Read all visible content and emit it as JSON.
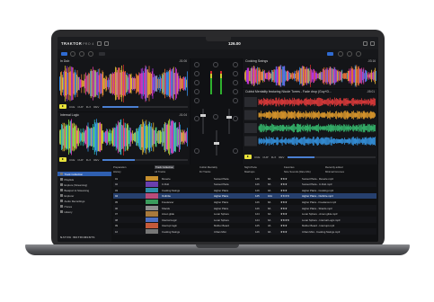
{
  "app": {
    "name": "TRAKTOR",
    "edition": "PRO 4",
    "brand": "NATIVE INSTRUMENTS"
  },
  "master": {
    "bpm": "126.00"
  },
  "colors": {
    "accent": "#2f6bd2",
    "play": "#e8e23a",
    "selection": "#26406e"
  },
  "decks": [
    {
      "id": "A",
      "title": "In Dub",
      "time": "-01:06",
      "position": 0.42
    },
    {
      "id": "B",
      "title": "Cooking Swings",
      "time": "-03:16",
      "position": 0.55
    },
    {
      "id": "C",
      "title": "Internal Logic",
      "time": "-01:04",
      "position": 0.38
    },
    {
      "id": "D",
      "title": "Cubist Mentality featuring Nicole Torres - Fade drop (Guy+D...",
      "time": "-05:01",
      "position": 0.3
    }
  ],
  "deck_buttons": [
    "CUE",
    "CUP",
    "FLX",
    "REV"
  ],
  "sidebar": {
    "items": [
      {
        "label": "Track Collection",
        "selected": true
      },
      {
        "label": "Playlists"
      },
      {
        "label": "Explore (Streaming)"
      },
      {
        "label": "Beatport & Streaming"
      },
      {
        "label": "Explorer"
      },
      {
        "label": "Audio Recordings"
      },
      {
        "label": "iTunes"
      },
      {
        "label": "History"
      }
    ]
  },
  "favorites": [
    "Preparation",
    "Track Collection",
    "Cubist Mentality",
    "Night Parte",
    "Favorites",
    "Recently added",
    "History",
    "All Tracks",
    "DJ Tracks",
    "Mashups",
    "Nice Sounds (Rare Mix)",
    "Minimal Grooves"
  ],
  "tracks": [
    {
      "n": "01",
      "title": "Reverie",
      "artist": "Sunset Plaza",
      "bpm": "126",
      "key": "8A",
      "rating": "★★★",
      "label": "Sunset Plaza - Reverie.mp3"
    },
    {
      "n": "02",
      "title": "In Dub",
      "artist": "Sunset Plaza",
      "bpm": "126",
      "key": "8A",
      "rating": "★★★",
      "label": "Sunset Plaza - In Dub.mp3"
    },
    {
      "n": "03",
      "title": "Cooking Swings",
      "artist": "Higher Plaza",
      "bpm": "126",
      "key": "9A",
      "rating": "★★★",
      "label": "Higher Plaza - Cooking.mp3"
    },
    {
      "n": "04",
      "title": "Outbrite",
      "artist": "Higher Plaza",
      "bpm": "125",
      "key": "10A",
      "rating": "★★★★",
      "label": "Higher Plaza - Outbrite.mp3",
      "selected": true
    },
    {
      "n": "05",
      "title": "Freelancer",
      "artist": "Higher Plaza",
      "bpm": "126",
      "key": "8A",
      "rating": "★★★",
      "label": "Higher Plaza - Freelancer.mp3"
    },
    {
      "n": "06",
      "title": "Shards",
      "artist": "Higher Plaza",
      "bpm": "126",
      "key": "8A",
      "rating": "★★★",
      "label": "Higher Plaza - Shards.mp3"
    },
    {
      "n": "07",
      "title": "Amen glide",
      "artist": "Lunar Sphere",
      "bpm": "124",
      "key": "6A",
      "rating": "★★★",
      "label": "Lunar Sphere - Amen glide.mp3"
    },
    {
      "n": "08",
      "title": "Internal Logic",
      "artist": "Lunar Sphere",
      "bpm": "124",
      "key": "6A",
      "rating": "★★★★",
      "label": "Lunar Sphere - Internal Logic.mp3"
    },
    {
      "n": "09",
      "title": "Interrupt login",
      "artist": "Mother Board",
      "bpm": "125",
      "key": "3A",
      "rating": "★★★",
      "label": "Mother Board - Interrupt.mp3"
    },
    {
      "n": "10",
      "title": "Cooking Swings",
      "artist": "Urban Mist",
      "bpm": "126",
      "key": "9A",
      "rating": "★★★",
      "label": "Urban Mist - Cooking Swings.mp3"
    }
  ]
}
